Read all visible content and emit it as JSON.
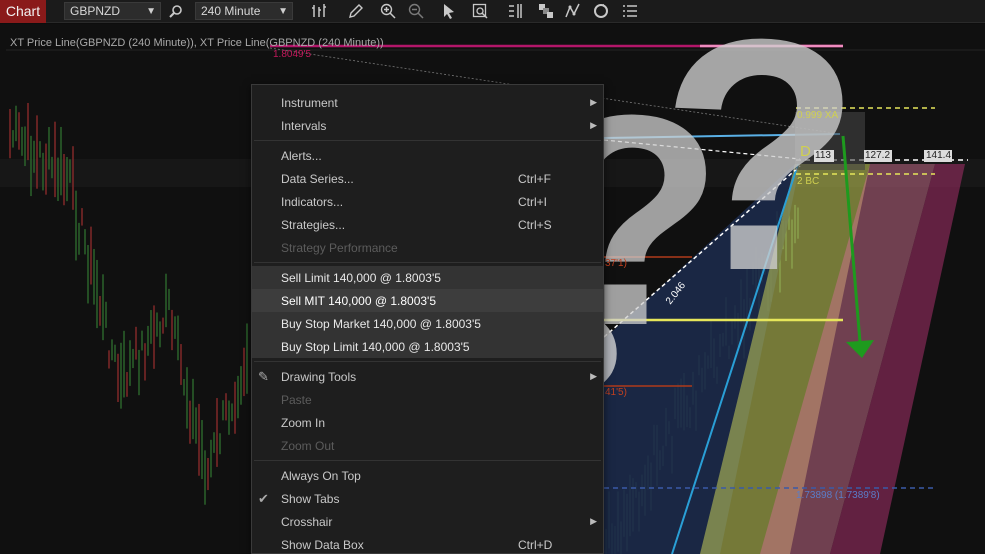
{
  "toolbar": {
    "chart_tab": "Chart",
    "symbol": "GBPNZD",
    "interval": "240 Minute",
    "icons": [
      "search-icon",
      "bar-chart-icon",
      "pencil-icon",
      "zoom-in-icon",
      "zoom-out-icon",
      "pointer-icon",
      "data-box-icon",
      "bars-icon",
      "layers-icon",
      "pattern-icon",
      "refresh-icon",
      "list-icon"
    ]
  },
  "chart": {
    "indicator_label": "XT Price Line(GBPNZD (240 Minute)), XT Price Line(GBPNZD (240 Minute))",
    "price_top": "1.8049'5",
    "xa_label": "0.999 XA",
    "d_label": "D",
    "fib_113": "113",
    "fib_127": "127.2",
    "fib_141": "141.4",
    "bc_label": "2 BC",
    "leg_label": "2.046",
    "level_37": "37'1)",
    "level_41": "41'5)",
    "bottom_price": "1.73898 (1.7389'8)",
    "colors": {
      "accent_red": "#8a1a1a",
      "magenta": "#c2185b",
      "yellow": "#e8e85a",
      "green": "#1fa01f",
      "white_qmark": "#d8d8d8"
    }
  },
  "menu": {
    "items": [
      {
        "label": "Instrument",
        "shortcut": "",
        "submenu": true
      },
      {
        "label": "Intervals",
        "shortcut": "",
        "submenu": true
      },
      {
        "label": "Alerts...",
        "shortcut": ""
      },
      {
        "label": "Data Series...",
        "shortcut": "Ctrl+F"
      },
      {
        "label": "Indicators...",
        "shortcut": "Ctrl+I"
      },
      {
        "label": "Strategies...",
        "shortcut": "Ctrl+S"
      },
      {
        "label": "Strategy Performance",
        "shortcut": ""
      },
      {
        "label": "Sell Limit 140,000 @ 1.8003'5",
        "shortcut": ""
      },
      {
        "label": "Sell MIT 140,000 @ 1.8003'5",
        "shortcut": ""
      },
      {
        "label": "Buy Stop Market 140,000 @ 1.8003'5",
        "shortcut": ""
      },
      {
        "label": "Buy Stop Limit 140,000 @ 1.8003'5",
        "shortcut": ""
      },
      {
        "label": "Drawing Tools",
        "shortcut": "",
        "submenu": true
      },
      {
        "label": "Paste",
        "shortcut": ""
      },
      {
        "label": "Zoom In",
        "shortcut": ""
      },
      {
        "label": "Zoom Out",
        "shortcut": ""
      },
      {
        "label": "Always On Top",
        "shortcut": ""
      },
      {
        "label": "Show Tabs",
        "shortcut": ""
      },
      {
        "label": "Crosshair",
        "shortcut": "",
        "submenu": true
      },
      {
        "label": "Show Data Box",
        "shortcut": "Ctrl+D"
      }
    ]
  }
}
